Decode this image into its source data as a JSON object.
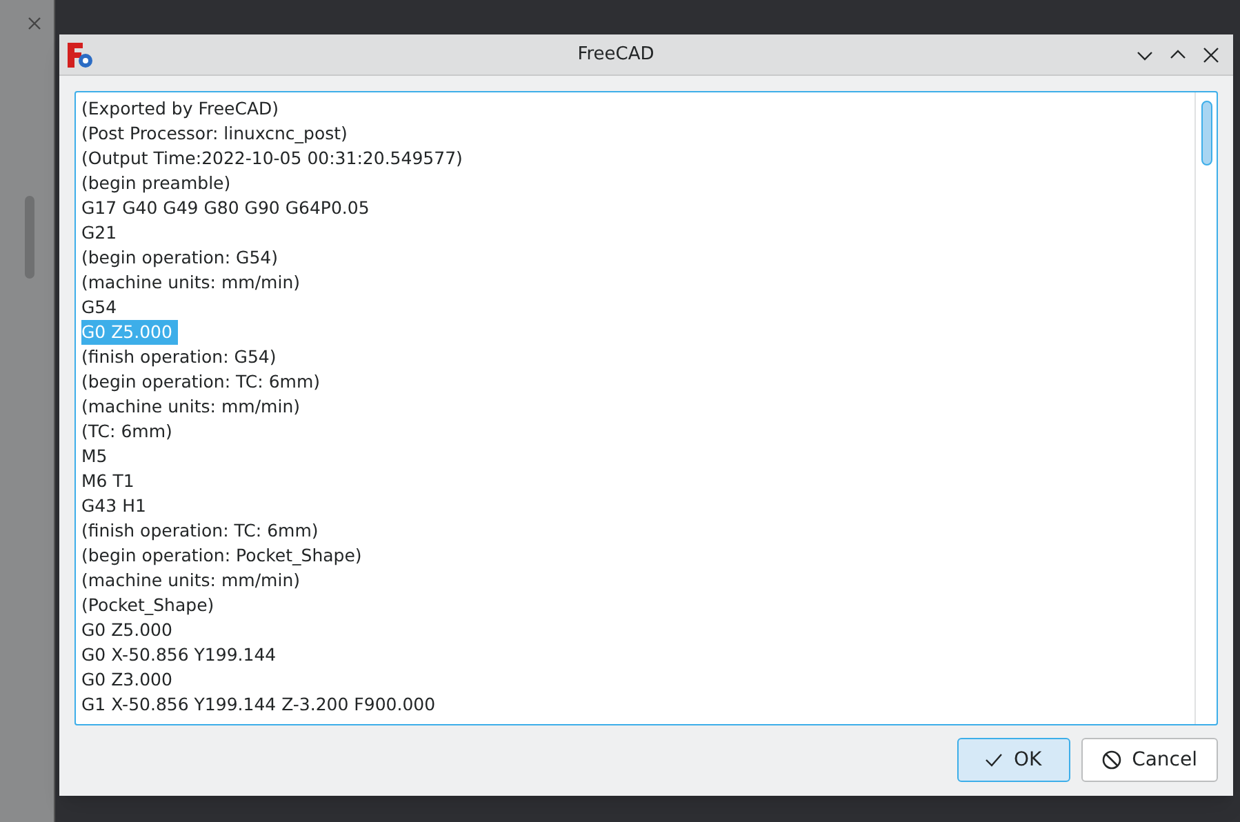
{
  "window": {
    "title": "FreeCAD"
  },
  "output": {
    "lines": [
      {
        "text": "(Exported by FreeCAD)",
        "selected": false
      },
      {
        "text": "(Post Processor: linuxcnc_post)",
        "selected": false
      },
      {
        "text": "(Output Time:2022-10-05 00:31:20.549577)",
        "selected": false
      },
      {
        "text": "(begin preamble)",
        "selected": false
      },
      {
        "text": "G17 G40 G49 G80 G90 G64P0.05",
        "selected": false
      },
      {
        "text": "G21",
        "selected": false
      },
      {
        "text": "(begin operation: G54)",
        "selected": false
      },
      {
        "text": "(machine units: mm/min)",
        "selected": false
      },
      {
        "text": "G54",
        "selected": false
      },
      {
        "text": "G0 Z5.000",
        "selected": true
      },
      {
        "text": "(finish operation: G54)",
        "selected": false
      },
      {
        "text": "(begin operation: TC: 6mm)",
        "selected": false
      },
      {
        "text": "(machine units: mm/min)",
        "selected": false
      },
      {
        "text": "(TC: 6mm)",
        "selected": false
      },
      {
        "text": "M5",
        "selected": false
      },
      {
        "text": "M6 T1",
        "selected": false
      },
      {
        "text": "G43 H1",
        "selected": false
      },
      {
        "text": "(finish operation: TC: 6mm)",
        "selected": false
      },
      {
        "text": "(begin operation: Pocket_Shape)",
        "selected": false
      },
      {
        "text": "(machine units: mm/min)",
        "selected": false
      },
      {
        "text": "(Pocket_Shape)",
        "selected": false
      },
      {
        "text": "G0 Z5.000",
        "selected": false
      },
      {
        "text": "G0 X-50.856 Y199.144",
        "selected": false
      },
      {
        "text": "G0 Z3.000",
        "selected": false
      },
      {
        "text": "G1 X-50.856 Y199.144 Z-3.200 F900.000",
        "selected": false
      }
    ]
  },
  "buttons": [
    {
      "kind": "ok",
      "label": "OK"
    },
    {
      "kind": "cancel",
      "label": "Cancel"
    }
  ]
}
